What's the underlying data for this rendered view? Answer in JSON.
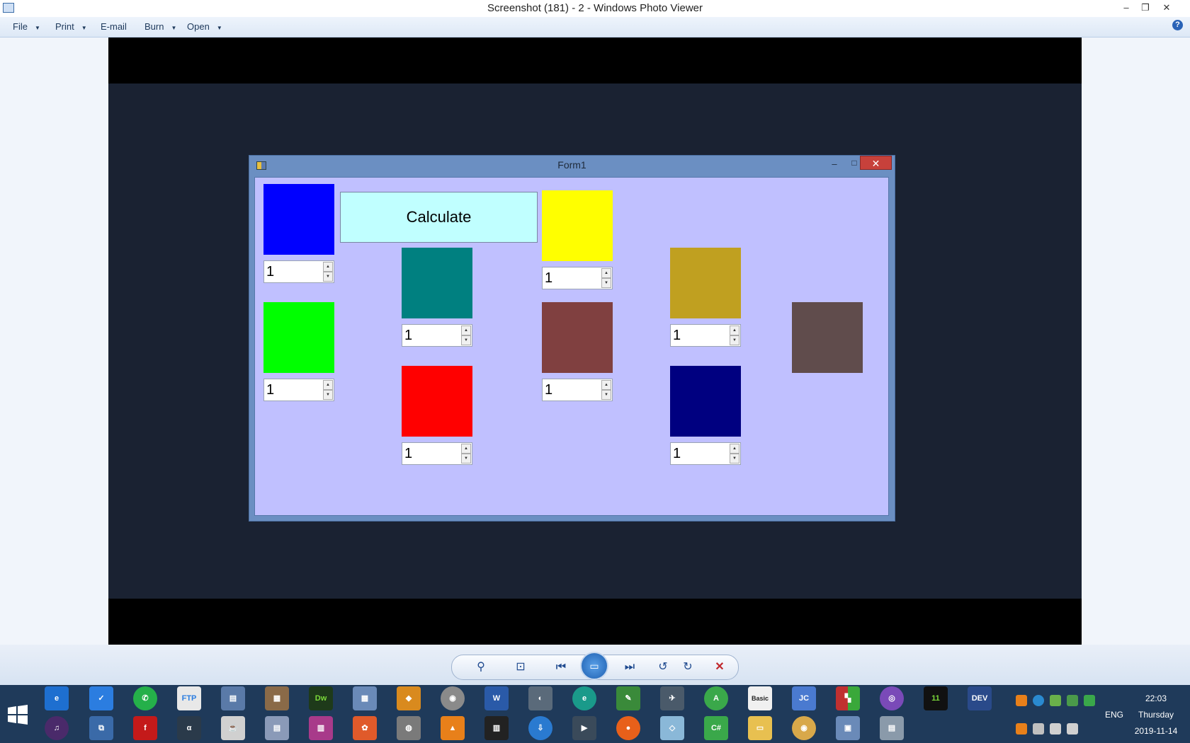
{
  "photo_viewer": {
    "title": "Screenshot (181) - 2 - Windows Photo Viewer",
    "window_controls": {
      "minimize": "–",
      "restore": "❐",
      "close": "✕"
    },
    "menu": [
      {
        "label": "File",
        "has_dropdown": true
      },
      {
        "label": "Print",
        "has_dropdown": true
      },
      {
        "label": "E-mail",
        "has_dropdown": false
      },
      {
        "label": "Burn",
        "has_dropdown": true
      },
      {
        "label": "Open",
        "has_dropdown": true
      }
    ],
    "help_icon": "?",
    "toolbar": {
      "zoom_icon": "zoom-icon",
      "fit_icon": "actual-size-icon",
      "prev_icon": "previous-icon",
      "slideshow_icon": "slideshow-icon",
      "next_icon": "next-icon",
      "rotate_ccw_icon": "rotate-counterclockwise-icon",
      "rotate_cw_icon": "rotate-clockwise-icon",
      "delete_icon": "delete-icon"
    }
  },
  "form1": {
    "title": "Form1",
    "calculate_label": "Calculate",
    "colors": {
      "client_bg": "#c0c0ff",
      "blue": "#0000ff",
      "green": "#00ff00",
      "teal": "#008080",
      "red": "#ff0000",
      "yellow": "#ffff00",
      "maroon": "#804040",
      "gold": "#c0a020",
      "navy": "#000080",
      "taupe": "#604c4c"
    },
    "spinners": {
      "blue": "1",
      "green": "1",
      "teal": "1",
      "red": "1",
      "yellow": "1",
      "maroon": "1",
      "gold": "1",
      "navy": "1"
    }
  },
  "taskbar": {
    "language": "ENG",
    "time": "22:03",
    "day": "Thursday",
    "date": "2019-11-14"
  }
}
